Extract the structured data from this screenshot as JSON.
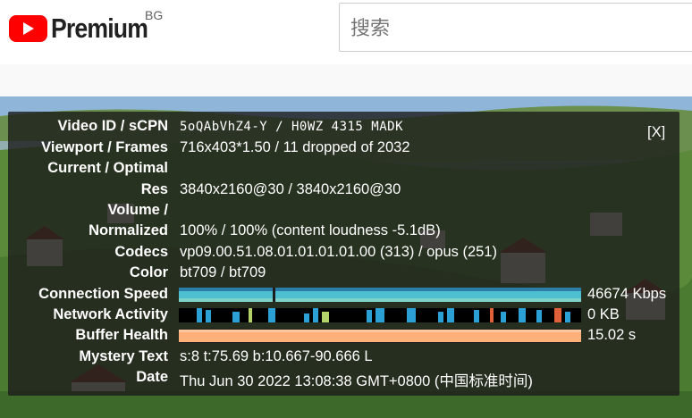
{
  "header": {
    "logo_text": "Premium",
    "country_code": "BG",
    "search_placeholder": "搜索"
  },
  "colors": {
    "brand_red": "#ff0000",
    "connection_graph": "#3fb0c4",
    "network_graph": "#2f9fd1",
    "buffer_graph": "#ffb07a"
  },
  "stats": {
    "close_label": "[X]",
    "rows": [
      {
        "label": "Video ID / sCPN",
        "value": "5oQAbVhZ4-Y / H0WZ 4315 MADK"
      },
      {
        "label": "Viewport / Frames",
        "value": "716x403*1.50 / 11 dropped of 2032"
      },
      {
        "label": "Current / Optimal",
        "value": ""
      },
      {
        "label": "Res",
        "value": "3840x2160@30 / 3840x2160@30"
      },
      {
        "label": "Volume /",
        "value": ""
      },
      {
        "label": "Normalized",
        "value": "100% / 100% (content loudness -5.1dB)"
      },
      {
        "label": "Codecs",
        "value": "vp09.00.51.08.01.01.01.01.00 (313) / opus (251)"
      },
      {
        "label": "Color",
        "value": "bt709 / bt709"
      },
      {
        "label": "Connection Speed",
        "value": "46674 Kbps"
      },
      {
        "label": "Network Activity",
        "value": "0 KB"
      },
      {
        "label": "Buffer Health",
        "value": "15.02 s"
      },
      {
        "label": "Mystery Text",
        "value": "s:8 t:75.69 b:10.667-90.666 L"
      },
      {
        "label": "Date",
        "value": "Thu Jun 30 2022 13:08:38 GMT+0800 (中国标准时间)"
      }
    ]
  }
}
